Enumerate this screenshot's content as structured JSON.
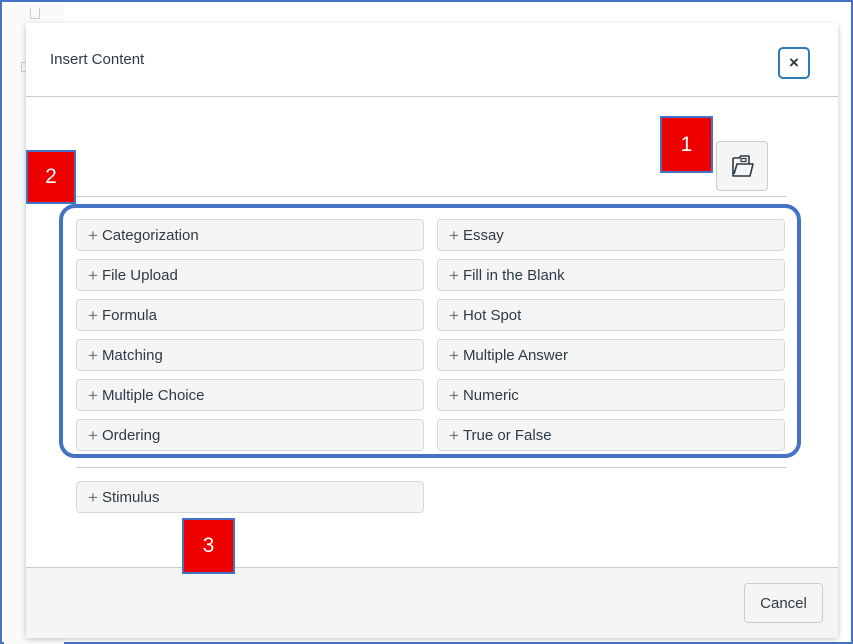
{
  "dialog": {
    "title": "Insert Content",
    "close_label": "×",
    "cancel_label": "Cancel"
  },
  "open_button": {
    "icon": "folder-open-icon"
  },
  "content_types": [
    {
      "label": "Categorization"
    },
    {
      "label": "Essay"
    },
    {
      "label": "File Upload"
    },
    {
      "label": "Fill in the Blank"
    },
    {
      "label": "Formula"
    },
    {
      "label": "Hot Spot"
    },
    {
      "label": "Matching"
    },
    {
      "label": "Multiple Answer"
    },
    {
      "label": "Multiple Choice"
    },
    {
      "label": "Numeric"
    },
    {
      "label": "Ordering"
    },
    {
      "label": "True or False"
    }
  ],
  "stimulus": {
    "label": "Stimulus"
  },
  "plus_symbol": "+",
  "callouts": {
    "one": "1",
    "two": "2",
    "three": "3"
  },
  "colors": {
    "callout_fill": "#ee0000",
    "annotation_blue": "#4472c4",
    "focus_ring": "#2b7abc"
  }
}
